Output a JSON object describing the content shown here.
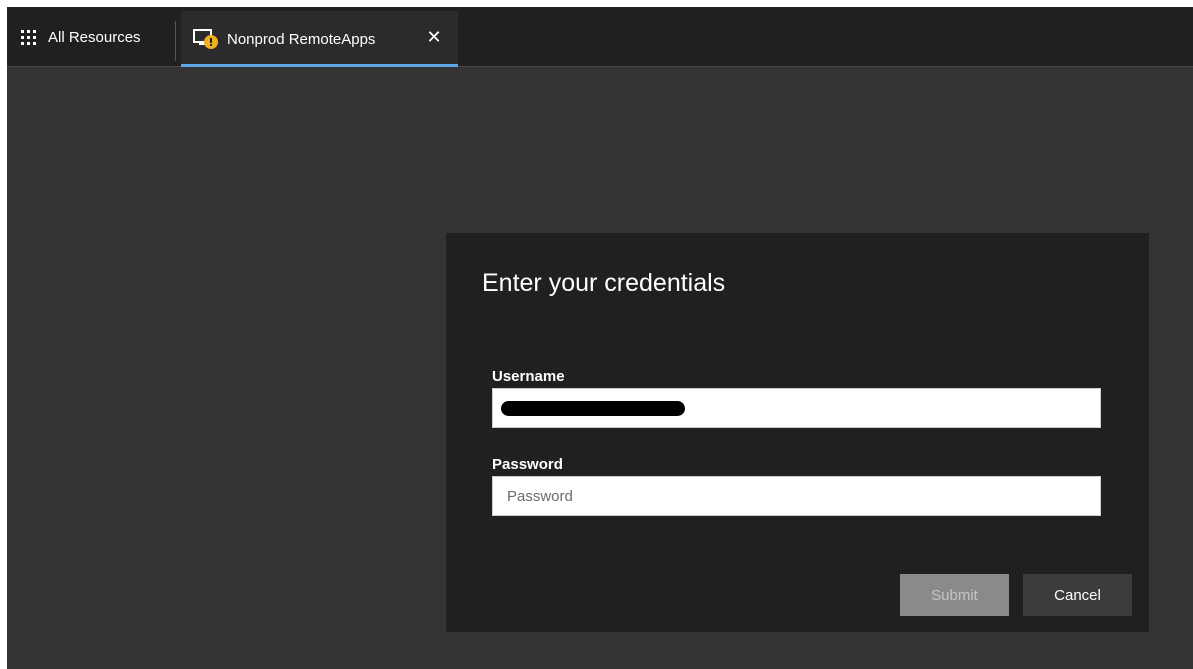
{
  "topbar": {
    "all_resources_label": "All Resources",
    "all_resources_icon": "app-grid-icon"
  },
  "tab": {
    "label": "Nonprod RemoteApps",
    "icon": "remote-desktop-warning-icon",
    "close_glyph": "✕",
    "accent_color": "#5ea8e8"
  },
  "dialog": {
    "title": "Enter your credentials",
    "username": {
      "label": "Username",
      "value": "",
      "redacted": true
    },
    "password": {
      "label": "Password",
      "placeholder": "Password"
    },
    "submit_label": "Submit",
    "cancel_label": "Cancel"
  }
}
